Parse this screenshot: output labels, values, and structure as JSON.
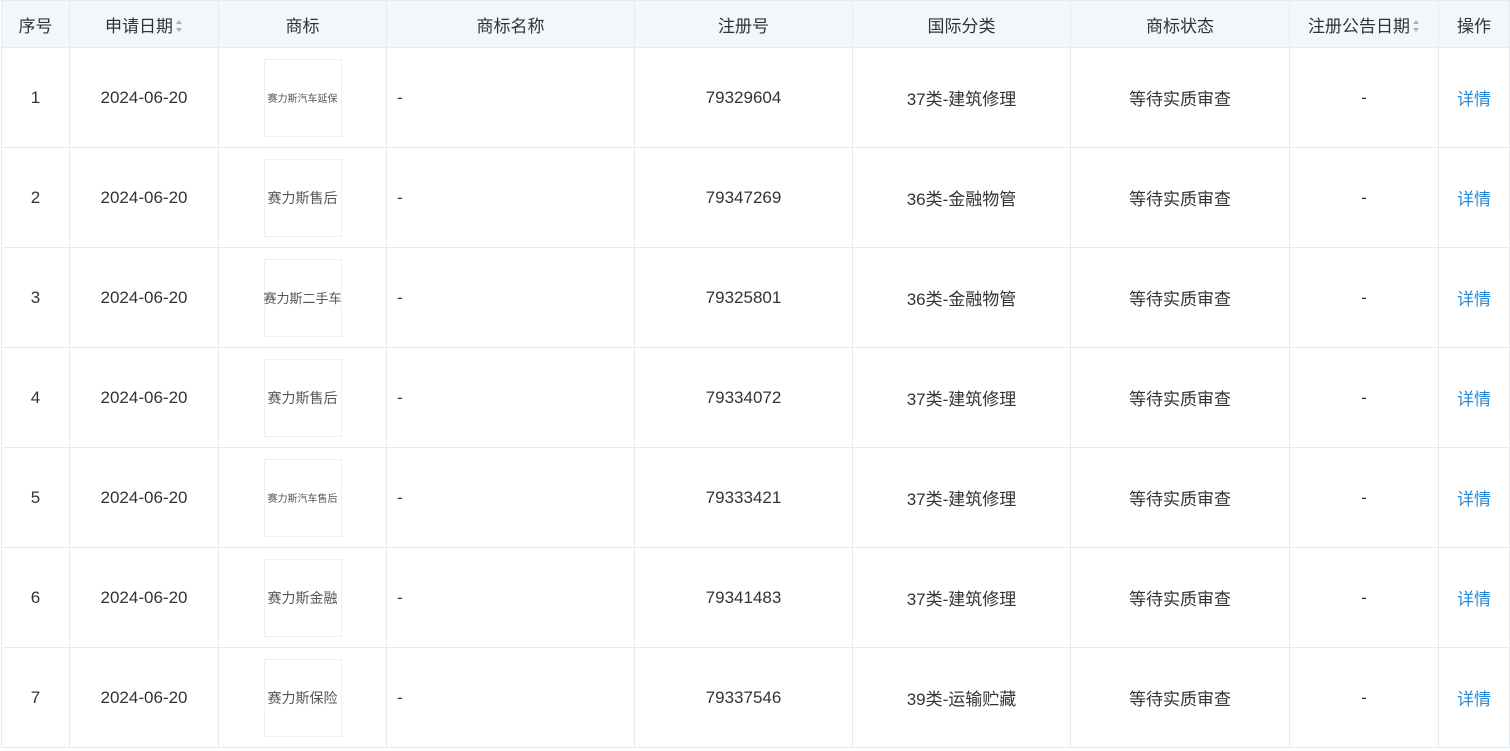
{
  "headers": {
    "index": "序号",
    "apply_date": "申请日期",
    "trademark": "商标",
    "trademark_name": "商标名称",
    "reg_no": "注册号",
    "intl_class": "国际分类",
    "status": "商标状态",
    "announce_date": "注册公告日期",
    "action": "操作"
  },
  "rows": [
    {
      "index": "1",
      "apply_date": "2024-06-20",
      "logo_text": "赛力斯汽车延保",
      "name": "-",
      "reg_no": "79329604",
      "intl_class": "37类-建筑修理",
      "status": "等待实质审查",
      "announce_date": "-",
      "action": "详情"
    },
    {
      "index": "2",
      "apply_date": "2024-06-20",
      "logo_text": "赛力斯售后",
      "name": "-",
      "reg_no": "79347269",
      "intl_class": "36类-金融物管",
      "status": "等待实质审查",
      "announce_date": "-",
      "action": "详情"
    },
    {
      "index": "3",
      "apply_date": "2024-06-20",
      "logo_text": "赛力斯二手车",
      "name": "-",
      "reg_no": "79325801",
      "intl_class": "36类-金融物管",
      "status": "等待实质审查",
      "announce_date": "-",
      "action": "详情"
    },
    {
      "index": "4",
      "apply_date": "2024-06-20",
      "logo_text": "赛力斯售后",
      "name": "-",
      "reg_no": "79334072",
      "intl_class": "37类-建筑修理",
      "status": "等待实质审查",
      "announce_date": "-",
      "action": "详情"
    },
    {
      "index": "5",
      "apply_date": "2024-06-20",
      "logo_text": "赛力斯汽车售后",
      "name": "-",
      "reg_no": "79333421",
      "intl_class": "37类-建筑修理",
      "status": "等待实质审查",
      "announce_date": "-",
      "action": "详情"
    },
    {
      "index": "6",
      "apply_date": "2024-06-20",
      "logo_text": "赛力斯金融",
      "name": "-",
      "reg_no": "79341483",
      "intl_class": "37类-建筑修理",
      "status": "等待实质审查",
      "announce_date": "-",
      "action": "详情"
    },
    {
      "index": "7",
      "apply_date": "2024-06-20",
      "logo_text": "赛力斯保险",
      "name": "-",
      "reg_no": "79337546",
      "intl_class": "39类-运输贮藏",
      "status": "等待实质审查",
      "announce_date": "-",
      "action": "详情"
    }
  ],
  "colors": {
    "header_bg": "#f2f7fb",
    "border": "#e4ecf2",
    "link": "#2a8ad6"
  }
}
